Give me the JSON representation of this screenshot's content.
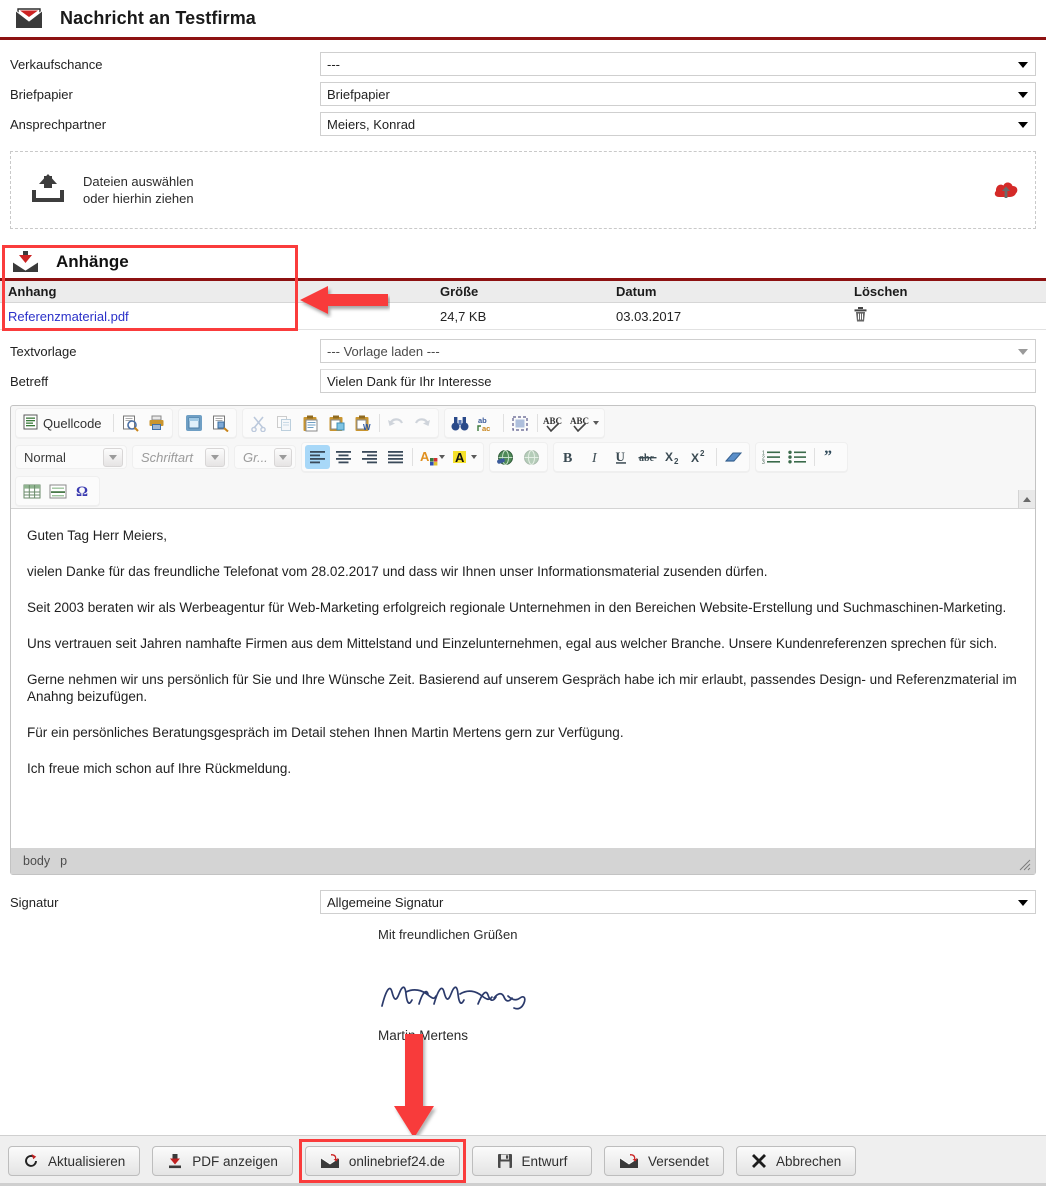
{
  "header": {
    "title": "Nachricht an Testfirma",
    "icon": "open-envelope-icon",
    "rule_color": "#8d1111"
  },
  "form": {
    "rows": [
      {
        "label": "Verkaufschance",
        "value": "---",
        "control": "select"
      },
      {
        "label": "Briefpapier",
        "value": "Briefpapier",
        "control": "select"
      },
      {
        "label": "Ansprechpartner",
        "value": "Meiers, Konrad",
        "control": "select"
      }
    ]
  },
  "dropzone": {
    "line1": "Dateien auswählen",
    "line2": "oder hierhin ziehen",
    "upload_icon": "upload-tray-icon",
    "cloud_icon": "cloud-upload-icon"
  },
  "attachments": {
    "section_title": "Anhänge",
    "section_icon": "inbox-download-icon",
    "columns": [
      "Anhang",
      "Größe",
      "Datum",
      "Löschen"
    ],
    "rows": [
      {
        "name": "Referenzmaterial.pdf",
        "size": "24,7 KB",
        "date": "03.03.2017",
        "delete_icon": "trash-icon"
      }
    ]
  },
  "template_row": {
    "label": "Textvorlage",
    "value": "--- Vorlage laden ---"
  },
  "subject_row": {
    "label": "Betreff",
    "value": "Vielen Dank für Ihr Interesse"
  },
  "editor": {
    "toolbar_row1": [
      {
        "name": "source-button",
        "label": "Quellcode",
        "icon": "source-code-icon"
      },
      {
        "name": "preview-button",
        "label": "",
        "icon": "preview-icon"
      },
      {
        "name": "print-button",
        "label": "",
        "icon": "printer-icon"
      },
      {
        "name": "templates-button",
        "label": "",
        "icon": "templates-icon"
      },
      {
        "name": "document-properties-button",
        "label": "",
        "icon": "doc-properties-icon"
      },
      {
        "name": "cut-button",
        "label": "",
        "icon": "scissors-icon"
      },
      {
        "name": "copy-button",
        "label": "",
        "icon": "copy-icon"
      },
      {
        "name": "paste-button",
        "label": "",
        "icon": "paste-icon"
      },
      {
        "name": "paste-text-button",
        "label": "",
        "icon": "paste-text-icon"
      },
      {
        "name": "paste-word-button",
        "label": "",
        "icon": "paste-word-icon"
      },
      {
        "name": "undo-button",
        "label": "",
        "icon": "undo-arrow-icon"
      },
      {
        "name": "redo-button",
        "label": "",
        "icon": "redo-arrow-icon"
      },
      {
        "name": "find-button",
        "label": "",
        "icon": "binoculars-icon"
      },
      {
        "name": "replace-button",
        "label": "",
        "icon": "replace-icon"
      },
      {
        "name": "select-all-button",
        "label": "",
        "icon": "select-all-icon"
      },
      {
        "name": "spellcheck-button",
        "label": "",
        "icon": "spellcheck-abc-icon"
      },
      {
        "name": "spellcheck-options-button",
        "label": "",
        "icon": "spellcheck-abc-dropdown-icon"
      }
    ],
    "paragraph_format": "Normal",
    "font_family": "Schriftart",
    "font_size": "Gr...",
    "toolbar_row2": [
      {
        "name": "align-left-button",
        "icon": "align-left-icon",
        "active": true
      },
      {
        "name": "align-center-button",
        "icon": "align-center-icon",
        "active": false
      },
      {
        "name": "align-right-button",
        "icon": "align-right-icon",
        "active": false
      },
      {
        "name": "align-justify-button",
        "icon": "align-justify-icon",
        "active": false
      },
      {
        "name": "text-color-button",
        "icon": "text-color-icon"
      },
      {
        "name": "background-color-button",
        "icon": "background-color-icon"
      },
      {
        "name": "insert-link-button",
        "icon": "globe-link-icon"
      },
      {
        "name": "unlink-button",
        "icon": "globe-unlink-icon"
      },
      {
        "name": "bold-button",
        "icon": "bold-icon",
        "glyph": "B"
      },
      {
        "name": "italic-button",
        "icon": "italic-icon",
        "glyph": "I"
      },
      {
        "name": "underline-button",
        "icon": "underline-icon",
        "glyph": "U"
      },
      {
        "name": "strikethrough-button",
        "icon": "strikethrough-icon",
        "glyph": "abc"
      },
      {
        "name": "subscript-button",
        "icon": "subscript-icon",
        "glyph": "X2"
      },
      {
        "name": "superscript-button",
        "icon": "superscript-icon",
        "glyph": "X2"
      },
      {
        "name": "remove-format-button",
        "icon": "eraser-icon"
      },
      {
        "name": "numbered-list-button",
        "icon": "numbered-list-icon"
      },
      {
        "name": "bulleted-list-button",
        "icon": "bulleted-list-icon"
      },
      {
        "name": "blockquote-button",
        "icon": "blockquote-icon",
        "glyph": "”"
      }
    ],
    "toolbar_row3": [
      {
        "name": "insert-table-button",
        "icon": "table-icon"
      },
      {
        "name": "horizontal-rule-button",
        "icon": "horizontal-rule-icon"
      },
      {
        "name": "special-character-button",
        "icon": "omega-icon",
        "glyph": "Ω"
      }
    ],
    "body_paragraphs": [
      "Guten Tag Herr Meiers,",
      "vielen Danke für das freundliche Telefonat vom 28.02.2017 und dass wir Ihnen unser Informationsmaterial zusenden dürfen.",
      "Seit 2003 beraten wir als Werbeagentur für Web-Marketing erfolgreich regionale Unternehmen in den Bereichen Website-Erstellung und Suchmaschinen-Marketing.",
      "Uns vertrauen seit Jahren namhafte Firmen aus dem Mittelstand und Einzelunternehmen, egal aus welcher Branche. Unsere Kundenreferenzen sprechen für sich.",
      "Gerne nehmen wir uns persönlich für Sie und Ihre Wünsche Zeit. Basierend auf unserem Gespräch habe ich mir erlaubt, passendes Design- und Referenzmaterial im Anahng beizufügen.",
      "Für ein persönliches Beratungsgespräch im Detail stehen Ihnen Martin Mertens gern zur Verfügung.",
      "Ich freue mich schon auf Ihre Rückmeldung."
    ],
    "status_path": [
      "body",
      "p"
    ]
  },
  "signature": {
    "label": "Signatur",
    "value": "Allgemeine Signatur",
    "greeting": "Mit freundlichen Grüßen",
    "signature_image": "handwritten-signature-image",
    "name": "Martin Mertens"
  },
  "buttons": [
    {
      "name": "refresh-button",
      "label": "Aktualisieren",
      "icon": "refresh-arrow-icon",
      "highlighted": false
    },
    {
      "name": "show-pdf-button",
      "label": "PDF anzeigen",
      "icon": "pdf-download-icon",
      "highlighted": false
    },
    {
      "name": "onlinebrief24-button",
      "label": "onlinebrief24.de",
      "icon": "envelope-send-icon",
      "highlighted": true
    },
    {
      "name": "draft-button",
      "label": "Entwurf",
      "icon": "floppy-save-icon",
      "highlighted": false
    },
    {
      "name": "sent-button",
      "label": "Versendet",
      "icon": "envelope-send-icon",
      "highlighted": false
    },
    {
      "name": "cancel-button",
      "label": "Abbrechen",
      "icon": "x-close-icon",
      "highlighted": false
    }
  ],
  "annotations": {
    "highlight_color": "#fa3c3c",
    "arrow_to_attachments": "left-pointing-red-arrow",
    "arrow_to_onlinebrief24": "down-pointing-red-arrow"
  }
}
